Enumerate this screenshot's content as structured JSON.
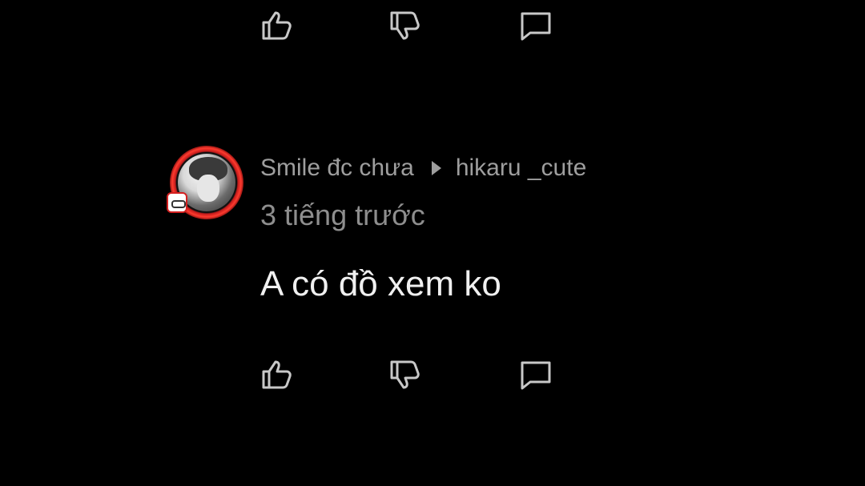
{
  "colors": {
    "background": "#000000",
    "icon": "#c8c8c8",
    "meta_text": "#9e9e9e",
    "body_text": "#f0f0f0",
    "avatar_ring": "#d32020"
  },
  "top_actions": {
    "like_icon": "thumbs-up-icon",
    "dislike_icon": "thumbs-down-icon",
    "reply_icon": "comment-icon"
  },
  "comment": {
    "author": "Smile đc chưa",
    "reply_to_icon": "play-arrow-icon",
    "reply_to": "hikaru _cute",
    "timestamp": "3 tiếng trước",
    "text": "A có đồ xem ko",
    "actions": {
      "like_icon": "thumbs-up-icon",
      "dislike_icon": "thumbs-down-icon",
      "reply_icon": "comment-icon"
    }
  }
}
